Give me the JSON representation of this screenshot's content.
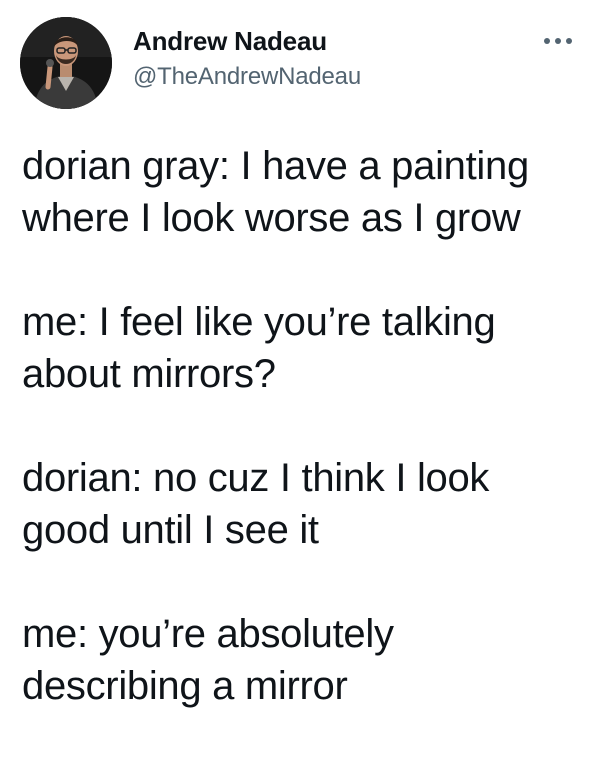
{
  "author": {
    "name": "Andrew Nadeau",
    "handle": "@TheAndrewNadeau",
    "avatar_icon": "user-avatar-photo"
  },
  "actions": {
    "more_icon": "more-options-icon"
  },
  "tweet": {
    "paragraphs": [
      {
        "lines": [
          "dorian gray: I have a painting",
          "where I look worse as I grow"
        ]
      },
      {
        "lines": [
          "me: I feel like you’re talking",
          "about mirrors?"
        ]
      },
      {
        "lines": [
          "dorian: no cuz I think I look",
          "good until I see it"
        ]
      },
      {
        "lines": [
          "me: you’re absolutely",
          "describing a mirror"
        ]
      }
    ]
  },
  "colors": {
    "text": "#0f1419",
    "secondary": "#536471",
    "background": "#ffffff"
  }
}
